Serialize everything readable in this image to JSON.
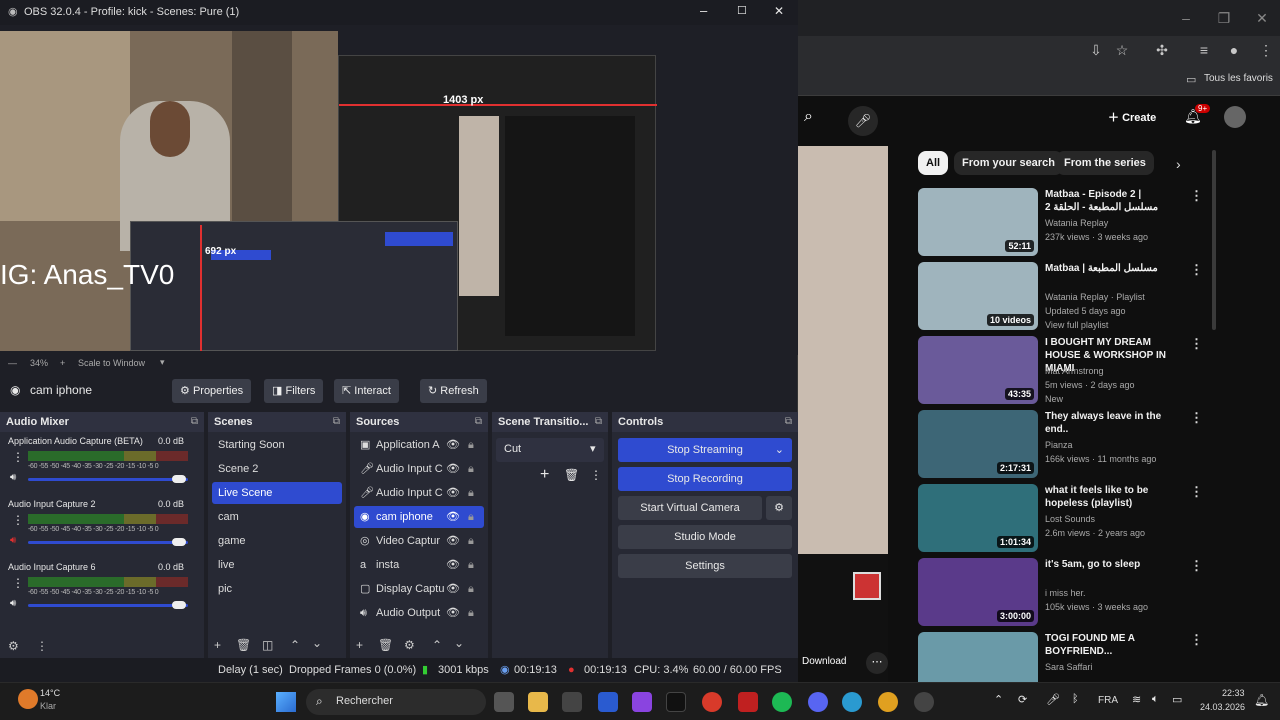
{
  "obs": {
    "title": "OBS 32.0.4 - Profile: kick - Scenes: Pure (1)",
    "preview": {
      "overlay_text": "IG: Anas_TV0",
      "px_label_1": "1403 px",
      "px_label_2": "692 px"
    },
    "scale": {
      "zoom": "34%",
      "mode": "Scale to Window"
    },
    "source_name": "cam iphone",
    "toolbar": {
      "properties": "Properties",
      "filters": "Filters",
      "interact": "Interact",
      "refresh": "Refresh"
    },
    "audio_mixer": {
      "title": "Audio Mixer",
      "channels": [
        {
          "name": "Application Audio Capture (BETA)",
          "db": "0.0 dB"
        },
        {
          "name": "Audio Input Capture 2",
          "db": "0.0 dB"
        },
        {
          "name": "Audio Input Capture 6",
          "db": "0.0 dB"
        }
      ],
      "scale": "-60 -55 -50 -45 -40 -35 -30 -25 -20 -15 -10 -5 0"
    },
    "scenes": {
      "title": "Scenes",
      "items": [
        "Starting Soon",
        "Scene 2",
        "Live Scene",
        "cam",
        "game",
        "live",
        "pic"
      ],
      "selected": "Live Scene"
    },
    "sources": {
      "title": "Sources",
      "items": [
        "Application A",
        "Audio Input C",
        "Audio Input C",
        "cam iphone",
        "Video Captur",
        "insta",
        "Display Captu",
        "Audio Output"
      ],
      "selected": "cam iphone"
    },
    "transitions": {
      "title": "Scene Transitio...",
      "value": "Cut"
    },
    "controls": {
      "title": "Controls",
      "stop_streaming": "Stop Streaming",
      "stop_recording": "Stop Recording",
      "virtual_camera": "Start Virtual Camera",
      "studio_mode": "Studio Mode",
      "settings": "Settings"
    },
    "status": {
      "delay": "Delay (1 sec)",
      "dropped": "Dropped Frames 0 (0.0%)",
      "bitrate": "3001 kbps",
      "stream_time": "00:19:13",
      "rec_time": "00:19:13",
      "cpu": "CPU: 3.4%",
      "fps": "60.00 / 60.00 FPS"
    }
  },
  "chrome": {
    "bookmarks_label": "Tous les favoris",
    "youtube": {
      "create_label": "Create",
      "notif_count": "9+",
      "chips": [
        "All",
        "From your search",
        "From the series"
      ],
      "download_label": "Download",
      "videos": [
        {
          "title": "Matbaa - Episode 2 | مسلسل المطبعة - الحلقة 2",
          "channel": "Watania Replay",
          "meta": "237k views · 3 weeks ago",
          "duration": "52:11",
          "thumb": "#9fb4bd"
        },
        {
          "title": "Matbaa | مسلسل المطبعة",
          "channel": "Watania Replay · Playlist",
          "meta": "Updated 5 days ago",
          "extra": "View full playlist",
          "duration": "10 videos",
          "thumb": "#9fb4bd"
        },
        {
          "title": "I BOUGHT MY DREAM HOUSE & WORKSHOP IN MIAMI",
          "channel": "Mat Armstrong",
          "meta": "5m views · 2 days ago",
          "extra": "New",
          "duration": "43:35",
          "thumb": "#6a5a9a"
        },
        {
          "title": "They always leave in the end..",
          "channel": "Pianza",
          "meta": "166k views · 11 months ago",
          "duration": "2:17:31",
          "thumb": "#3d6676"
        },
        {
          "title": "what it feels like to be hopeless (playlist)",
          "channel": "Lost Sounds",
          "meta": "2.6m views · 2 years ago",
          "duration": "1:01:34",
          "thumb": "#2f6f7a"
        },
        {
          "title": "it's 5am, go to sleep",
          "channel": "i miss her.",
          "meta": "105k views · 3 weeks ago",
          "duration": "3:00:00",
          "thumb": "#5a3a8a"
        },
        {
          "title": "TOGI FOUND ME A BOYFRIEND...",
          "channel": "Sara Saffari",
          "meta": "",
          "duration": "",
          "thumb": "#6a9aa8"
        }
      ]
    }
  },
  "taskbar": {
    "weather_temp": "14°C",
    "weather_desc": "Klar",
    "search": "Rechercher",
    "lang": "FRA",
    "time": "22:33",
    "date": "24.03.2026"
  }
}
